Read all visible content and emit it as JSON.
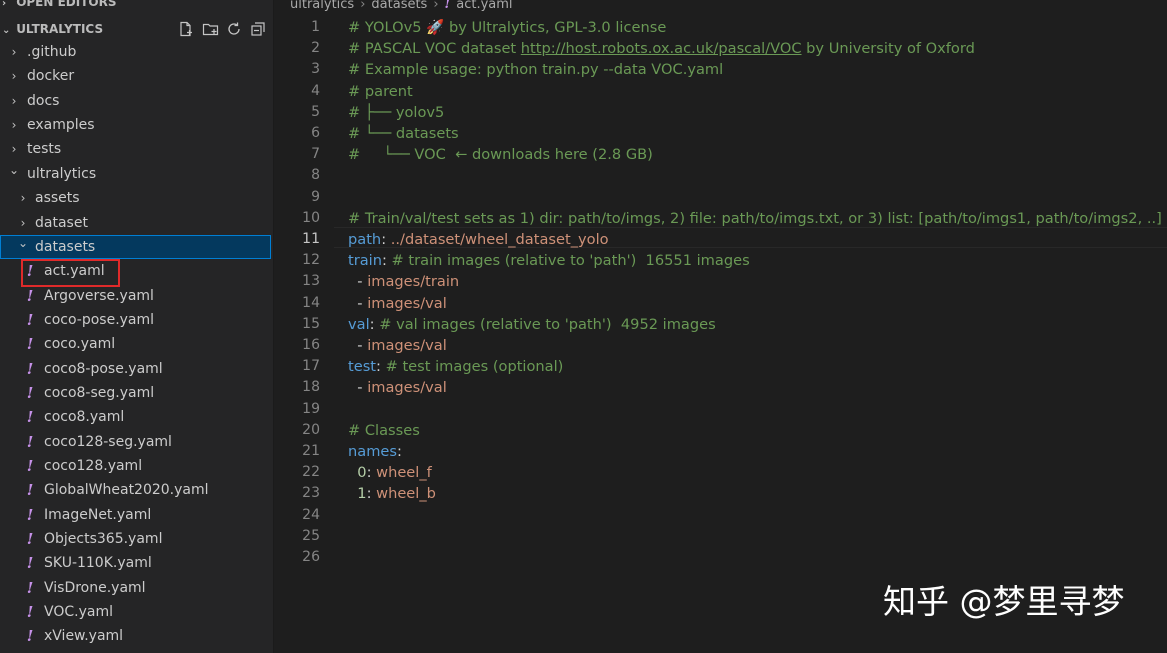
{
  "sidebar": {
    "open_editors_title": "OPEN EDITORS",
    "project_title": "ULTRALYTICS",
    "header_actions": [
      "new-file-icon",
      "new-folder-icon",
      "refresh-icon",
      "collapse-all-icon"
    ],
    "tree": [
      {
        "label": ".github",
        "type": "folder",
        "expanded": false,
        "depth": 0
      },
      {
        "label": "docker",
        "type": "folder",
        "expanded": false,
        "depth": 0
      },
      {
        "label": "docs",
        "type": "folder",
        "expanded": false,
        "depth": 0
      },
      {
        "label": "examples",
        "type": "folder",
        "expanded": false,
        "depth": 0
      },
      {
        "label": "tests",
        "type": "folder",
        "expanded": false,
        "depth": 0
      },
      {
        "label": "ultralytics",
        "type": "folder",
        "expanded": true,
        "depth": 0
      },
      {
        "label": "assets",
        "type": "folder",
        "expanded": false,
        "depth": 1
      },
      {
        "label": "dataset",
        "type": "folder",
        "expanded": false,
        "depth": 1
      },
      {
        "label": "datasets",
        "type": "folder",
        "expanded": true,
        "depth": 1,
        "selected": true
      },
      {
        "label": "act.yaml",
        "type": "file",
        "depth": 2
      },
      {
        "label": "Argoverse.yaml",
        "type": "file",
        "depth": 2
      },
      {
        "label": "coco-pose.yaml",
        "type": "file",
        "depth": 2
      },
      {
        "label": "coco.yaml",
        "type": "file",
        "depth": 2
      },
      {
        "label": "coco8-pose.yaml",
        "type": "file",
        "depth": 2
      },
      {
        "label": "coco8-seg.yaml",
        "type": "file",
        "depth": 2
      },
      {
        "label": "coco8.yaml",
        "type": "file",
        "depth": 2
      },
      {
        "label": "coco128-seg.yaml",
        "type": "file",
        "depth": 2
      },
      {
        "label": "coco128.yaml",
        "type": "file",
        "depth": 2
      },
      {
        "label": "GlobalWheat2020.yaml",
        "type": "file",
        "depth": 2
      },
      {
        "label": "ImageNet.yaml",
        "type": "file",
        "depth": 2
      },
      {
        "label": "Objects365.yaml",
        "type": "file",
        "depth": 2
      },
      {
        "label": "SKU-110K.yaml",
        "type": "file",
        "depth": 2
      },
      {
        "label": "VisDrone.yaml",
        "type": "file",
        "depth": 2
      },
      {
        "label": "VOC.yaml",
        "type": "file",
        "depth": 2
      },
      {
        "label": "xView.yaml",
        "type": "file",
        "depth": 2
      }
    ]
  },
  "breadcrumb": {
    "parts": [
      "ultralytics",
      "datasets",
      "act.yaml"
    ],
    "file_icon_glyph": "!"
  },
  "editor": {
    "active_line": 11,
    "lines": [
      [
        {
          "t": "c",
          "v": "# YOLOv5 "
        },
        {
          "t": "r",
          "v": "🚀"
        },
        {
          "t": "c",
          "v": " by Ultralytics, GPL-3.0 license"
        }
      ],
      [
        {
          "t": "c",
          "v": "# PASCAL VOC dataset "
        },
        {
          "t": "l",
          "v": "http://host.robots.ox.ac.uk/pascal/VOC"
        },
        {
          "t": "c",
          "v": " by University of Oxford"
        }
      ],
      [
        {
          "t": "c",
          "v": "# Example usage: python train.py --data VOC.yaml"
        }
      ],
      [
        {
          "t": "c",
          "v": "# parent"
        }
      ],
      [
        {
          "t": "c",
          "v": "# ├── yolov5"
        }
      ],
      [
        {
          "t": "c",
          "v": "# └── datasets"
        }
      ],
      [
        {
          "t": "c",
          "v": "#     └── VOC  ← downloads here (2.8 GB)"
        }
      ],
      [],
      [],
      [
        {
          "t": "c",
          "v": "# Train/val/test sets as 1) dir: path/to/imgs, 2) file: path/to/imgs.txt, or 3) list: [path/to/imgs1, path/to/imgs2, ..]"
        }
      ],
      [
        {
          "t": "k",
          "v": "path"
        },
        {
          "t": "p",
          "v": ": "
        },
        {
          "t": "s",
          "v": "../dataset/wheel_dataset_yolo"
        }
      ],
      [
        {
          "t": "k",
          "v": "train"
        },
        {
          "t": "p",
          "v": ": "
        },
        {
          "t": "c",
          "v": "# train images (relative to 'path')  16551 images"
        }
      ],
      [
        {
          "t": "p",
          "v": "  - "
        },
        {
          "t": "s",
          "v": "images/train"
        }
      ],
      [
        {
          "t": "p",
          "v": "  - "
        },
        {
          "t": "s",
          "v": "images/val"
        }
      ],
      [
        {
          "t": "k",
          "v": "val"
        },
        {
          "t": "p",
          "v": ": "
        },
        {
          "t": "c",
          "v": "# val images (relative to 'path')  4952 images"
        }
      ],
      [
        {
          "t": "p",
          "v": "  - "
        },
        {
          "t": "s",
          "v": "images/val"
        }
      ],
      [
        {
          "t": "k",
          "v": "test"
        },
        {
          "t": "p",
          "v": ": "
        },
        {
          "t": "c",
          "v": "# test images (optional)"
        }
      ],
      [
        {
          "t": "p",
          "v": "  - "
        },
        {
          "t": "s",
          "v": "images/val"
        }
      ],
      [],
      [
        {
          "t": "c",
          "v": "# Classes"
        }
      ],
      [
        {
          "t": "k",
          "v": "names"
        },
        {
          "t": "p",
          "v": ":"
        }
      ],
      [
        {
          "t": "p",
          "v": "  "
        },
        {
          "t": "n",
          "v": "0"
        },
        {
          "t": "p",
          "v": ": "
        },
        {
          "t": "s",
          "v": "wheel_f"
        }
      ],
      [
        {
          "t": "p",
          "v": "  "
        },
        {
          "t": "n",
          "v": "1"
        },
        {
          "t": "p",
          "v": ": "
        },
        {
          "t": "s",
          "v": "wheel_b"
        }
      ],
      [],
      [],
      []
    ]
  },
  "watermark": "知乎 @梦里寻梦",
  "colors": {
    "comment": "#6a9955",
    "key": "#569cd6",
    "string": "#ce9178",
    "number": "#b5cea8",
    "yaml_icon": "#c792ea",
    "selection": "#04395e",
    "highlight_box": "#e02a2a"
  }
}
